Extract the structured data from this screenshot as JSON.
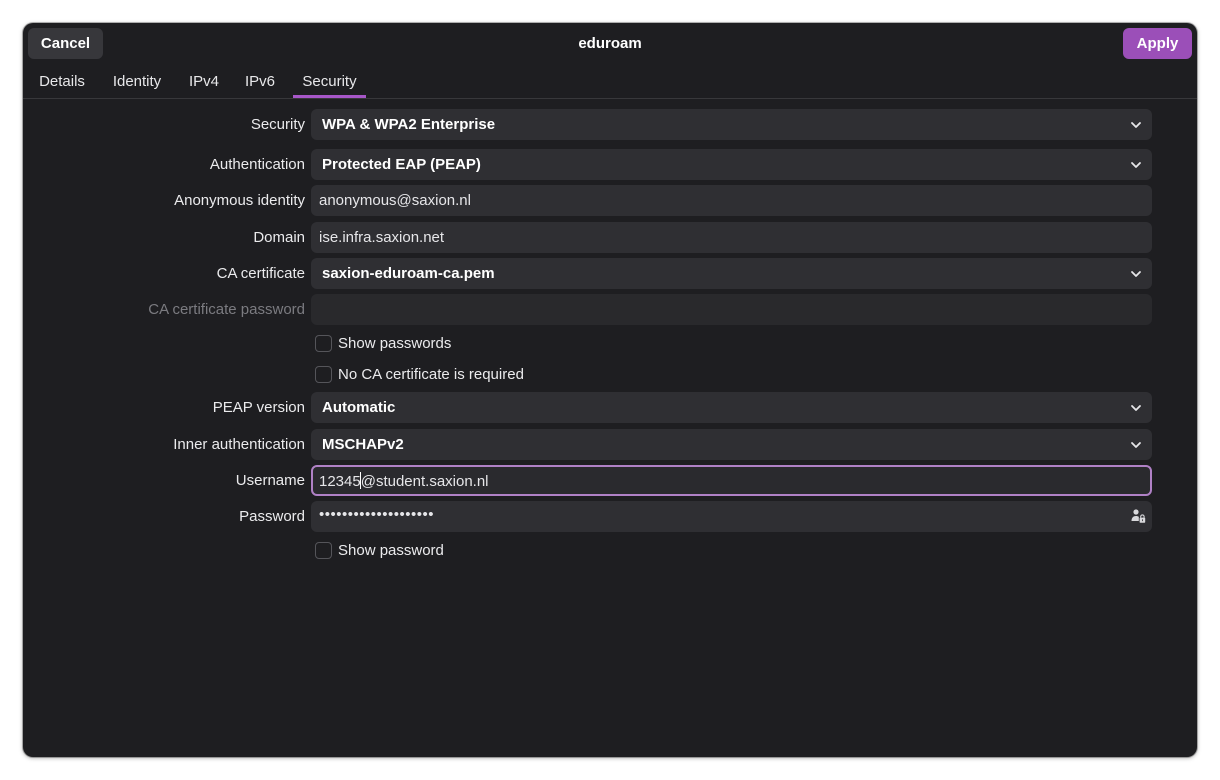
{
  "header": {
    "title": "eduroam",
    "cancel_label": "Cancel",
    "apply_label": "Apply",
    "accent_color": "#9b4fb8"
  },
  "tabs": [
    {
      "label": "Details",
      "active": false
    },
    {
      "label": "Identity",
      "active": false
    },
    {
      "label": "IPv4",
      "active": false
    },
    {
      "label": "IPv6",
      "active": false
    },
    {
      "label": "Security",
      "active": true
    }
  ],
  "form": {
    "security": {
      "label": "Security",
      "value": "WPA & WPA2 Enterprise"
    },
    "authentication": {
      "label": "Authentication",
      "value": "Protected EAP (PEAP)"
    },
    "anonymous_identity": {
      "label": "Anonymous identity",
      "value": "anonymous@saxion.nl"
    },
    "domain": {
      "label": "Domain",
      "value": "ise.infra.saxion.net"
    },
    "ca_certificate": {
      "label": "CA certificate",
      "value": "saxion-eduroam-ca.pem"
    },
    "ca_certificate_password": {
      "label": "CA certificate password",
      "value": ""
    },
    "show_passwords": {
      "label": "Show passwords",
      "checked": false
    },
    "no_ca_required": {
      "label": "No CA certificate is required",
      "checked": false
    },
    "peap_version": {
      "label": "PEAP version",
      "value": "Automatic"
    },
    "inner_authentication": {
      "label": "Inner authentication",
      "value": "MSCHAPv2"
    },
    "username": {
      "label": "Username",
      "value_before_cursor": "12345",
      "value_after_cursor": "@student.saxion.nl"
    },
    "password": {
      "label": "Password",
      "masked_value": "••••••••••••••••••••",
      "icon": "user-password-icon"
    },
    "show_password": {
      "label": "Show password",
      "checked": false
    }
  }
}
